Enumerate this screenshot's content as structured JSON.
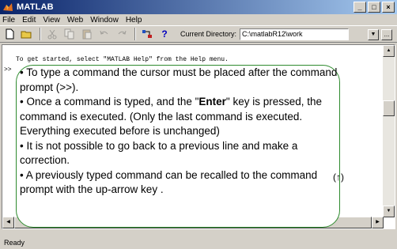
{
  "window": {
    "title": "MATLAB",
    "buttons": [
      "_",
      "□",
      "×"
    ]
  },
  "menubar": {
    "items": [
      "File",
      "Edit",
      "View",
      "Web",
      "Window",
      "Help"
    ]
  },
  "toolbar": {
    "help_glyph": "?",
    "current_directory_label": "Current Directory:",
    "current_directory_value": "C:\\matlabR12\\work",
    "dropdown_glyph": "▼",
    "browse_glyph": "..."
  },
  "command_window": {
    "startup_message": "To get started, select \"MATLAB Help\" from the Help menu.",
    "prompt": ">>"
  },
  "callout": {
    "bullet1": "• To type a command the cursor must be placed after the command prompt (>>).",
    "bullet2_pre": "• Once a command is typed, and the \"",
    "bullet2_key": "Enter",
    "bullet2_post": "\" key is pressed, the command is executed.  (Only the last command is executed.  Everything executed before is unchanged)",
    "bullet3": "• It is not possible to go back to a previous line and make a correction.",
    "bullet4": "• A previously typed command can be recalled to the command prompt with the up-arrow key      .",
    "up_arrow_note": "(↑)"
  },
  "statusbar": {
    "text": "Ready"
  }
}
